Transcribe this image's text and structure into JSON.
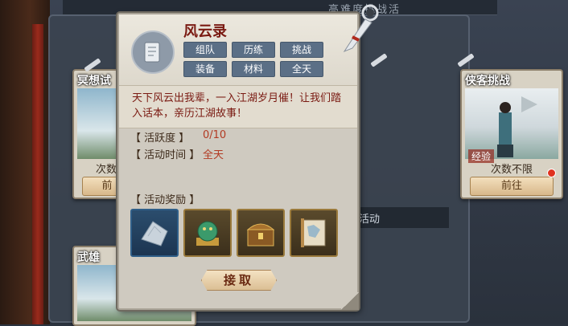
{
  "background": {
    "top_bar_text": "高难度挑战活",
    "left_card": {
      "title": "冥想试",
      "count": "次数",
      "button": "前"
    },
    "right_card": {
      "title": "侠客挑战",
      "exp_badge": "经验",
      "count": "次数不限",
      "button": "前往"
    },
    "lower_left_card": {
      "title": "武雄"
    },
    "mid_label": "活动"
  },
  "popup": {
    "title": "风云录",
    "tags": [
      "组队",
      "历练",
      "挑战",
      "装备",
      "材料",
      "全天"
    ],
    "description": "天下风云出我辈，一入江湖岁月催！让我们踏入话本，亲历江湖故事！",
    "activity_label": "【 活跃度 】",
    "activity_value": "0/10",
    "time_label": "【 活动时间 】",
    "time_value": "全天",
    "reward_label": "【 活动奖励 】",
    "rewards": [
      "fabric-material-icon",
      "jade-dragon-seal-icon",
      "treasure-chest-icon",
      "scroll-map-icon"
    ],
    "claim_button": "接取"
  },
  "colors": {
    "title_red": "#7a1a12",
    "tag_blue": "#5b6f86",
    "value_red": "#b23a22"
  }
}
